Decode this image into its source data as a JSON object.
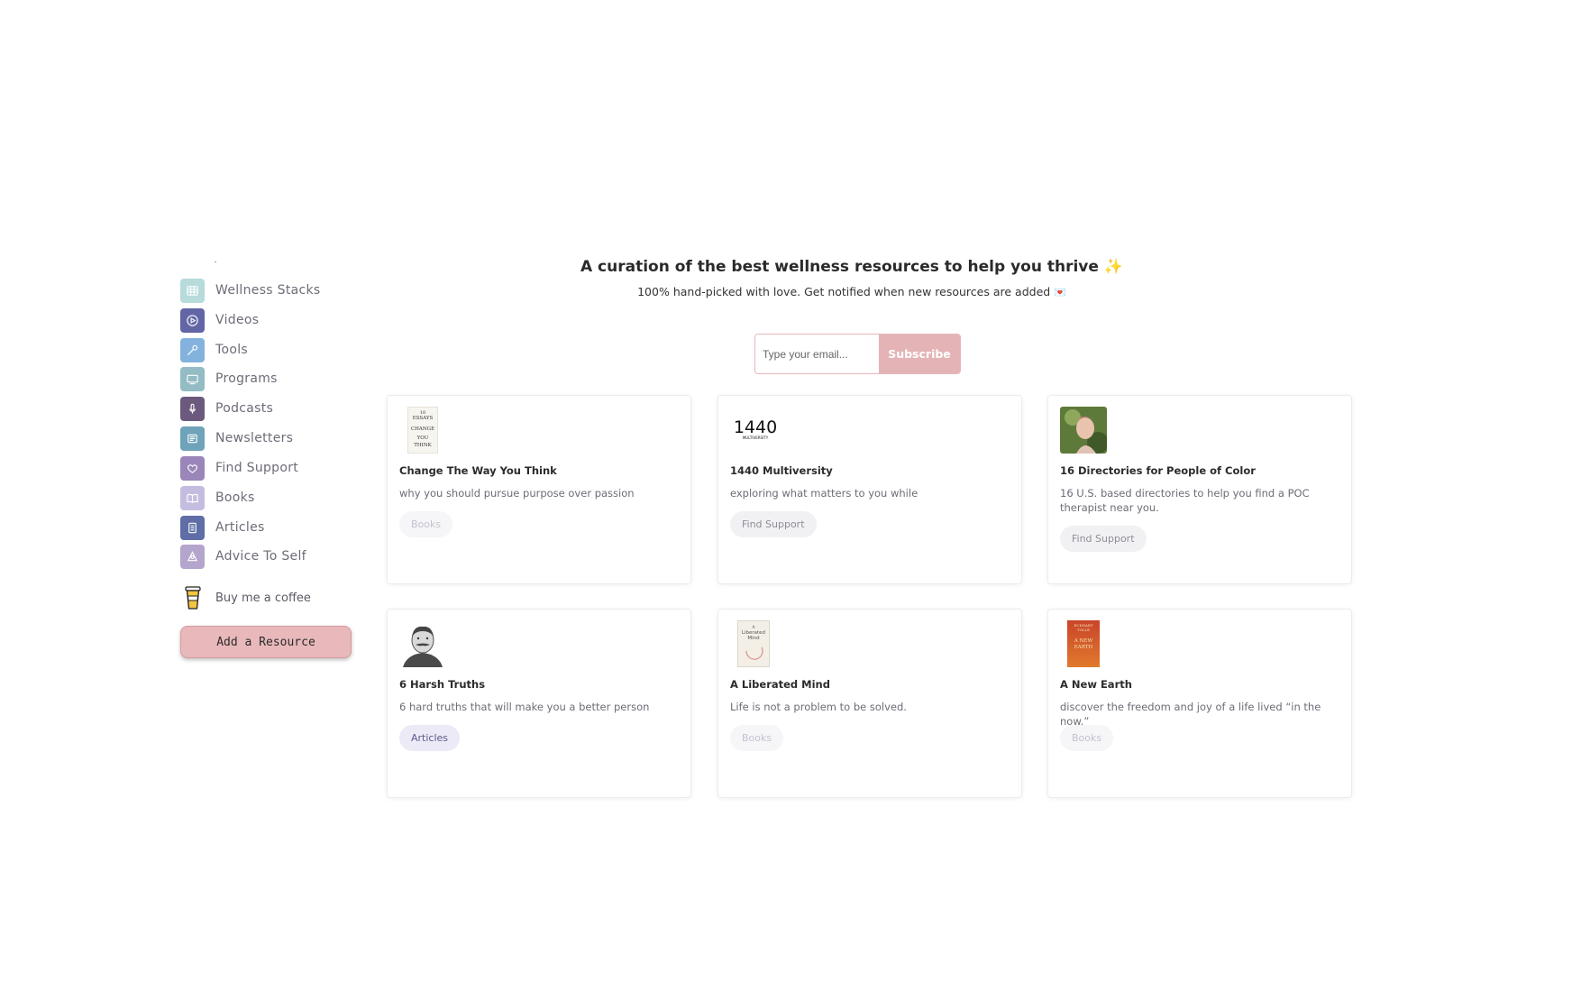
{
  "sidebar": {
    "items": [
      {
        "label": "Wellness Stacks",
        "icon": "grid-icon",
        "color": "#b7dadb"
      },
      {
        "label": "Videos",
        "icon": "play-icon",
        "color": "#6266a6"
      },
      {
        "label": "Tools",
        "icon": "wrench-icon",
        "color": "#83b3dd"
      },
      {
        "label": "Programs",
        "icon": "screen-icon",
        "color": "#93bcc4"
      },
      {
        "label": "Podcasts",
        "icon": "microphone-icon",
        "color": "#6c5a7e"
      },
      {
        "label": "Newsletters",
        "icon": "newspaper-icon",
        "color": "#6fa3ba"
      },
      {
        "label": "Find Support",
        "icon": "heart-icon",
        "color": "#9a86b8"
      },
      {
        "label": "Books",
        "icon": "book-icon",
        "color": "#c5bde0"
      },
      {
        "label": "Articles",
        "icon": "article-icon",
        "color": "#5f6ea7"
      },
      {
        "label": "Advice To Self",
        "icon": "advice-icon",
        "color": "#b4a5cd"
      }
    ],
    "coffee_label": "Buy me a coffee",
    "add_button_label": "Add a Resource"
  },
  "hero": {
    "title": "A curation of the best wellness resources to help you thrive",
    "title_emoji": "✨",
    "subtitle": "100% hand-picked with love. Get notified when new resources are added",
    "subtitle_emoji": "💌"
  },
  "subscribe": {
    "placeholder": "Type your email...",
    "button_label": "Subscribe"
  },
  "cards": [
    {
      "title": "Change The Way You Think",
      "description": "why you should pursue purpose over passion",
      "tag": "Books",
      "thumb_text": [
        "10",
        "ESSAYS",
        "CHANGE",
        "YOU",
        "THINK"
      ]
    },
    {
      "title": "1440 Multiversity",
      "description": "exploring what matters to you while",
      "tag": "Find Support",
      "thumb_text": [
        "1440",
        "MULTIVERSITY"
      ]
    },
    {
      "title": "16 Directories for People of Color",
      "description": "16 U.S. based directories to help you find a POC therapist near you.",
      "tag": "Find Support"
    },
    {
      "title": "6 Harsh Truths",
      "description": "6 hard truths that will make you a better person",
      "tag": "Articles"
    },
    {
      "title": "A Liberated Mind",
      "description": "Life is not a problem to be solved.",
      "tag": "Books",
      "thumb_text": [
        "A",
        "Liberated",
        "Mind"
      ]
    },
    {
      "title": "A New Earth",
      "description": "discover the freedom and joy of a life lived “in the now.”",
      "tag": "Books",
      "thumb_text": [
        "ECKHART",
        "TOLLE",
        "A NEW",
        "EARTH"
      ]
    }
  ],
  "colors": {
    "accent_pink": "#e4b3b6",
    "text_dark": "#2b2b2b",
    "text_muted": "#6c6c78",
    "coffee_cup": "#f4c542"
  }
}
